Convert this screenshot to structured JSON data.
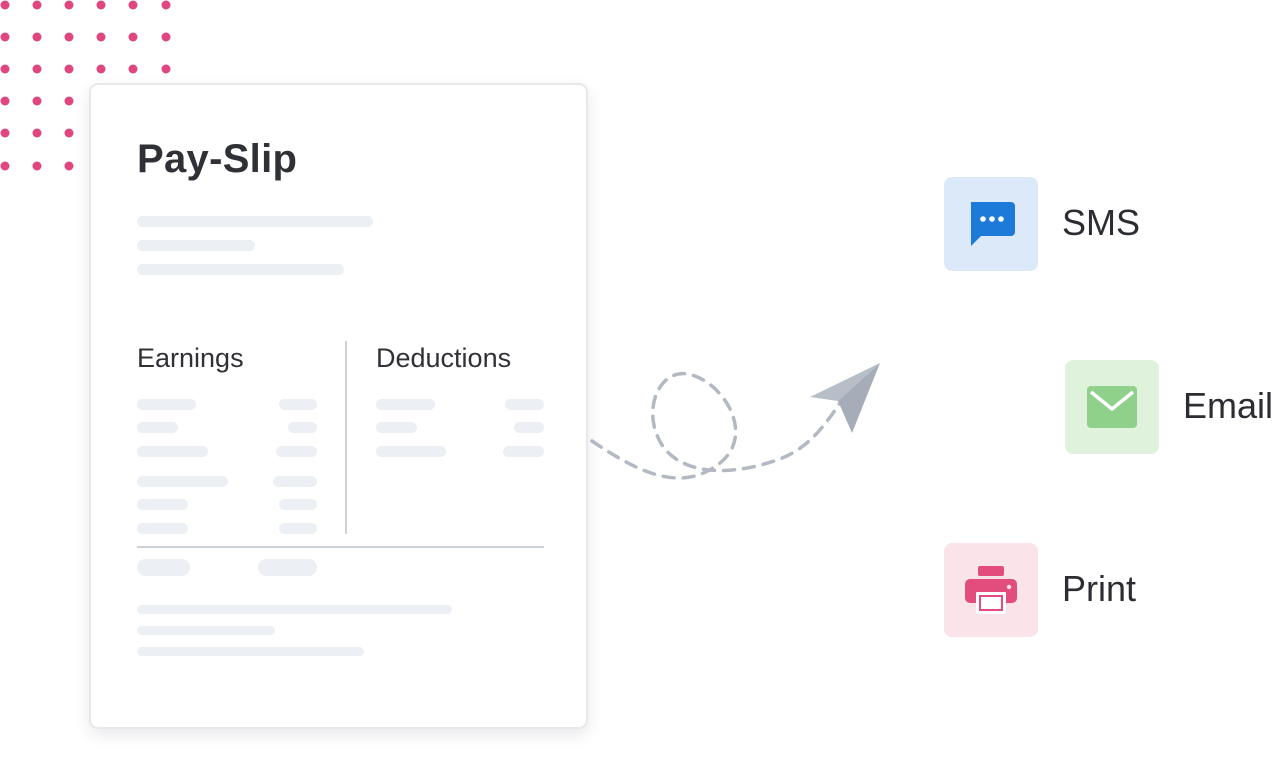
{
  "payslip": {
    "title": "Pay-Slip",
    "earnings_label": "Earnings",
    "deductions_label": "Deductions"
  },
  "channels": [
    {
      "label": "SMS",
      "icon": "sms-chat-icon",
      "tile_color": "#dbe9f9",
      "icon_color": "#1e7ad8"
    },
    {
      "label": "Email",
      "icon": "envelope-icon",
      "tile_color": "#dff3dc",
      "icon_color": "#8fd18a"
    },
    {
      "label": "Print",
      "icon": "printer-icon",
      "tile_color": "#fbe3ea",
      "icon_color": "#e24d7e"
    }
  ],
  "colors": {
    "accent_dots": "#e0467f",
    "placeholder": "#eceff3",
    "path": "#b3b9c3"
  }
}
